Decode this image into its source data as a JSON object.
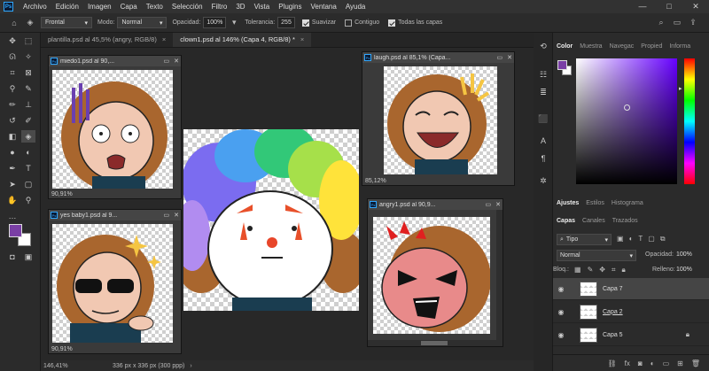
{
  "app": {
    "logo": "Ps"
  },
  "menu": [
    "Archivo",
    "Edición",
    "Imagen",
    "Capa",
    "Texto",
    "Selección",
    "Filtro",
    "3D",
    "Vista",
    "Plugins",
    "Ventana",
    "Ayuda"
  ],
  "window_controls": {
    "minimize": "—",
    "maximize": "□",
    "close": "✕"
  },
  "options": {
    "mode_select": "Frontal",
    "mode_label": "Modo:",
    "mode_value": "Normal",
    "opacity_label": "Opacidad:",
    "opacity_value": "100%",
    "tolerance_label": "Tolerancia:",
    "tolerance_value": "255",
    "smooth_label": "Suavizar",
    "smooth_checked": true,
    "contiguous_label": "Contiguo",
    "contiguous_checked": false,
    "all_layers_label": "Todas las capas",
    "all_layers_checked": true
  },
  "tabs": [
    {
      "label": "plantilla.psd al 45,5% (angry, RGB/8)",
      "close": "×",
      "active": false
    },
    {
      "label": "clown1.psd al 146% (Capa 4, RGB/8) *",
      "close": "×",
      "active": true
    }
  ],
  "documents": {
    "miedo": {
      "title": "miedo1.psd al 90,...",
      "zoom": "90,91%"
    },
    "yes_baby": {
      "title": "yes baby1.psd al 9...",
      "zoom": "90,91%"
    },
    "laugh": {
      "title": "laugh.psd al 85,1% (Capa...",
      "zoom": "85,12%"
    },
    "angry": {
      "title": "angry1.psd al 90,9...",
      "zoom": ""
    }
  },
  "status": {
    "zoom": "146,41%",
    "info": "336 px x 336 px (300 ppp)"
  },
  "color_panel": {
    "tabs": [
      "Color",
      "Muestra",
      "Navegac",
      "Propied",
      "Informa"
    ],
    "foreground": "#7a3fa5",
    "hue": "#6600ff"
  },
  "adjust_tabs": [
    "Ajustes",
    "Estilos",
    "Histograma"
  ],
  "layers_panel": {
    "tabs": [
      "Capas",
      "Canales",
      "Trazados"
    ],
    "filter_label": "Tipo",
    "blend_mode": "Normal",
    "opacity_label": "Opacidad:",
    "opacity_value": "100%",
    "lock_label": "Bloq.:",
    "fill_label": "Relleno:",
    "fill_value": "100%",
    "layers": [
      {
        "name": "Capa 7",
        "selected": true
      },
      {
        "name": "Capa 2",
        "selected": false
      },
      {
        "name": "Capa 5",
        "selected": false
      }
    ]
  }
}
